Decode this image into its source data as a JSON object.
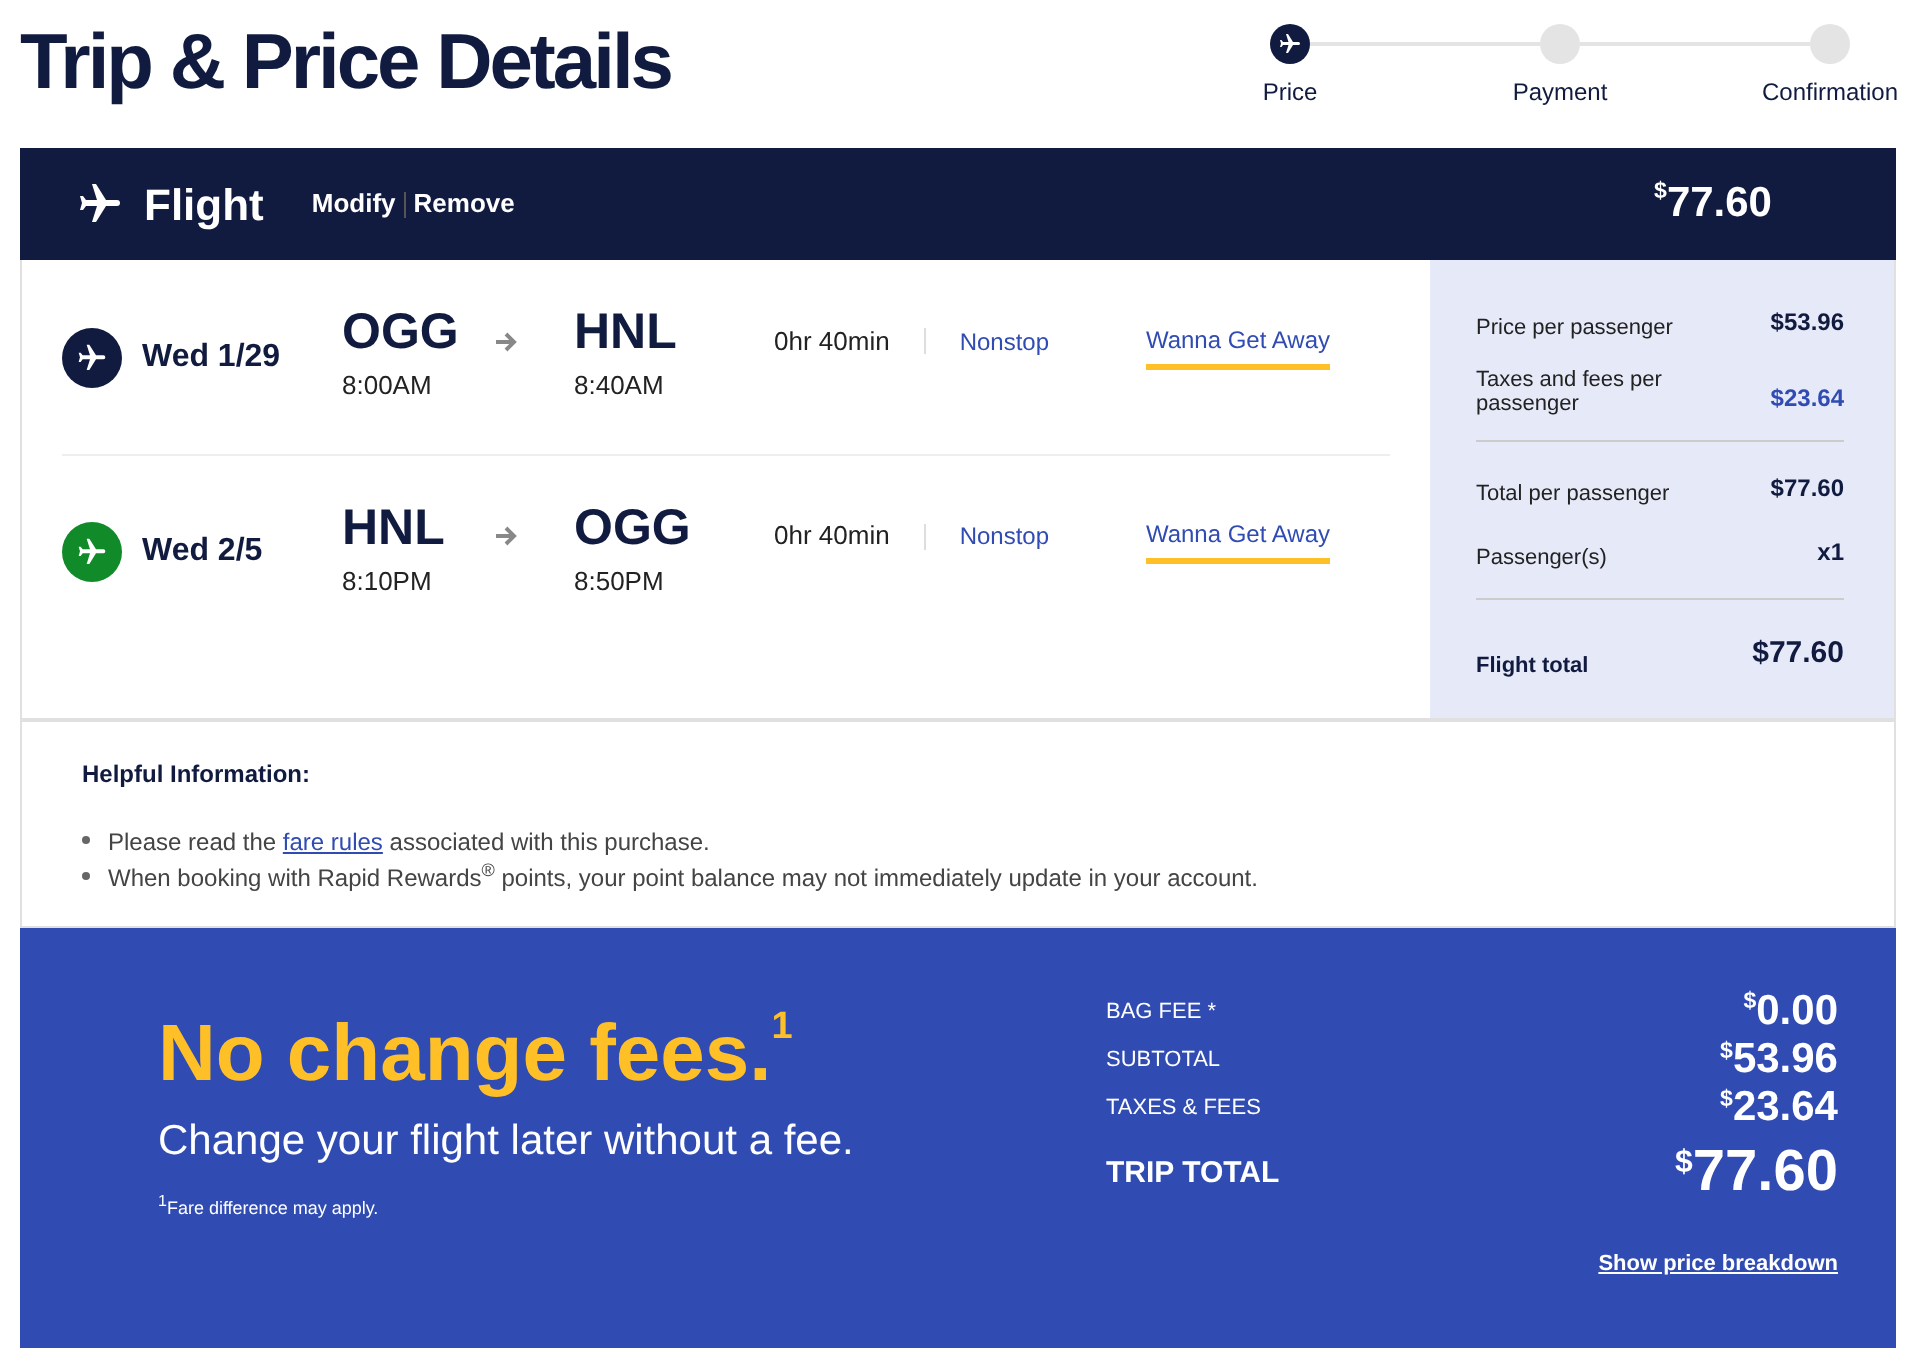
{
  "title": "Trip & Price Details",
  "steps": [
    {
      "label": "Price",
      "selected": true
    },
    {
      "label": "Payment",
      "selected": false
    },
    {
      "label": "Confirmation",
      "selected": false
    }
  ],
  "flight_header": {
    "title": "Flight",
    "links": [
      "Modify",
      "Remove"
    ],
    "currency": "$",
    "amount": "77.60"
  },
  "legs": [
    {
      "color": "#111b40",
      "date": "Wed 1/29",
      "from": "OGG",
      "depart": "8:00AM",
      "to": "HNL",
      "arrive": "8:40AM",
      "duration": "0hr 40min",
      "stops": "Nonstop",
      "fare": "Wanna Get Away"
    },
    {
      "color": "#118a2a",
      "date": "Wed 2/5",
      "from": "HNL",
      "depart": "8:10PM",
      "to": "OGG",
      "arrive": "8:50PM",
      "duration": "0hr 40min",
      "stops": "Nonstop",
      "fare": "Wanna Get Away"
    }
  ],
  "price_summary": [
    {
      "kind": "line",
      "label": "Price per passenger",
      "value": "$53.96"
    },
    {
      "kind": "accent",
      "label": "Taxes and fees per passenger",
      "value": "$23.64"
    },
    {
      "kind": "divider-line",
      "label": "Total per passenger",
      "value": "$77.60"
    },
    {
      "kind": "line",
      "label": "Passenger(s)",
      "value": "x1"
    },
    {
      "kind": "total",
      "label": "Flight total",
      "value": "$77.60"
    }
  ],
  "helpful_info": {
    "title": "Helpful Information:",
    "items": [
      {
        "before": "Please read the ",
        "link": "fare rules",
        "after": " associated with this purchase."
      },
      {
        "before": "When booking with Rapid Rewards$^{®}$ points, your point balance may not immediately update in your account."
      }
    ]
  },
  "promo": {
    "headline": "No change fees.$^{1}$",
    "subline": "Change your flight later without a fee.",
    "footnote": "$^{1}$Fare difference may apply."
  },
  "totals": [
    {
      "kind": "line",
      "label": "BAG FEE *",
      "currency": "$",
      "amount": "0.00"
    },
    {
      "kind": "line",
      "label": "SUBTOTAL",
      "currency": "$",
      "amount": "53.96"
    },
    {
      "kind": "line",
      "label": "TAXES & FEES",
      "currency": "$",
      "amount": "23.64"
    },
    {
      "kind": "total",
      "label": "TRIP TOTAL",
      "currency": "$",
      "amount": "77.60"
    }
  ],
  "breakdown_link": "Show price breakdown"
}
